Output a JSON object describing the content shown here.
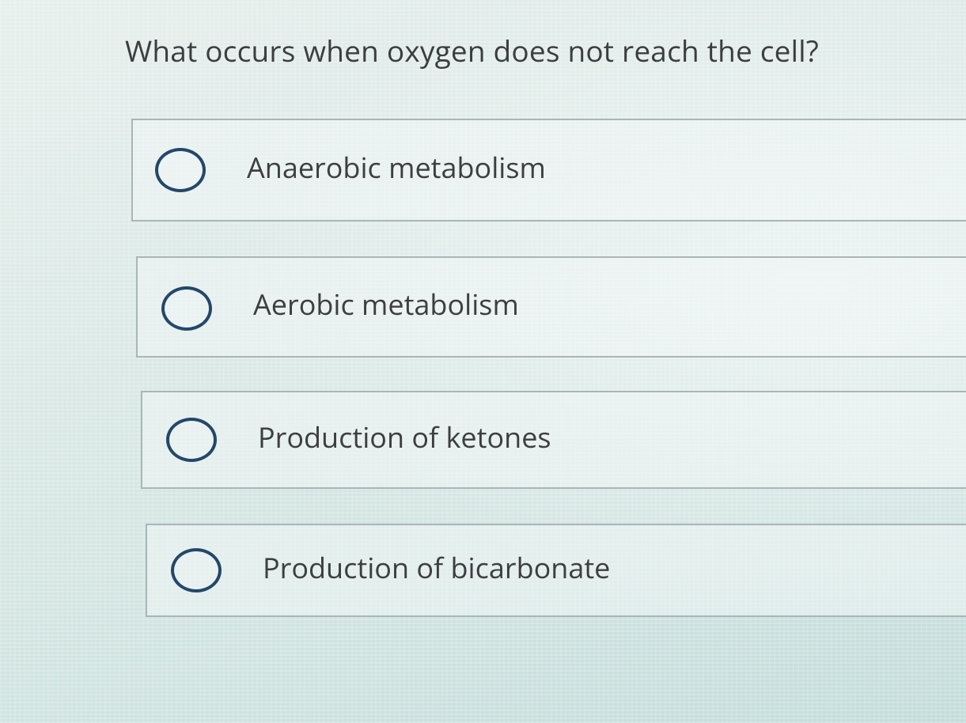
{
  "question": {
    "text": "What occurs when oxygen does not reach the cell?"
  },
  "options": [
    {
      "label": "Anaerobic metabolism",
      "selected": false
    },
    {
      "label": "Aerobic metabolism",
      "selected": false
    },
    {
      "label": "Production of ketones",
      "selected": false
    },
    {
      "label": "Production of bicarbonate",
      "selected": false
    }
  ],
  "colors": {
    "radio_ring": "#24476a",
    "text": "#3d3e41",
    "border": "#a9b6b8"
  }
}
